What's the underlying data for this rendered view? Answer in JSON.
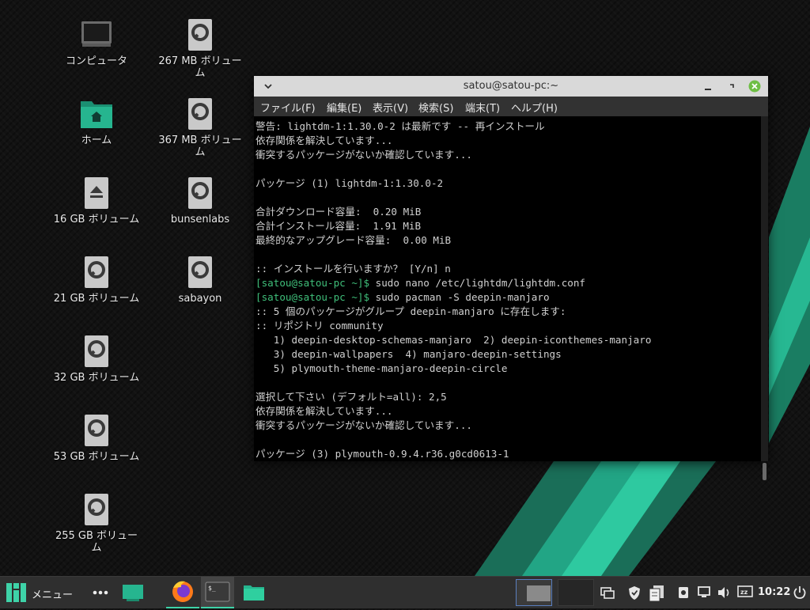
{
  "desktop_icons": [
    {
      "label": "コンピュータ",
      "icon": "monitor-icon"
    },
    {
      "label": "267 MB ボリューム",
      "icon": "drive-icon"
    },
    {
      "label": "ホーム",
      "icon": "home-folder-icon"
    },
    {
      "label": "367 MB ボリューム",
      "icon": "drive-icon"
    },
    {
      "label": "16 GB ボリューム",
      "icon": "eject-drive-icon"
    },
    {
      "label": "bunsenlabs",
      "icon": "drive-icon"
    },
    {
      "label": "21 GB ボリューム",
      "icon": "drive-icon"
    },
    {
      "label": "sabayon",
      "icon": "drive-icon"
    },
    {
      "label": "32 GB ボリューム",
      "icon": "drive-icon"
    },
    {
      "label": "53 GB ボリューム",
      "icon": "drive-icon"
    },
    {
      "label": "255 GB ボリューム",
      "icon": "drive-icon"
    }
  ],
  "terminal": {
    "title": "satou@satou-pc:~",
    "menu": [
      "ファイル(F)",
      "編集(E)",
      "表示(V)",
      "検索(S)",
      "端末(T)",
      "ヘルプ(H)"
    ],
    "lines": [
      {
        "text": "警告: lightdm-1:1.30.0-2 は最新です -- 再インストール"
      },
      {
        "text": "依存関係を解決しています..."
      },
      {
        "text": "衝突するパッケージがないか確認しています..."
      },
      {
        "text": ""
      },
      {
        "text": "パッケージ (1) lightdm-1:1.30.0-2"
      },
      {
        "text": ""
      },
      {
        "text": "合計ダウンロード容量:  0.20 MiB"
      },
      {
        "text": "合計インストール容量:  1.91 MiB"
      },
      {
        "text": "最終的なアップグレード容量:  0.00 MiB"
      },
      {
        "text": ""
      },
      {
        "text": ":: インストールを行いますか？ [Y/n] n"
      },
      {
        "prompt": "[satou@satou-pc ~]$",
        "text": " sudo nano /etc/lightdm/lightdm.conf"
      },
      {
        "prompt": "[satou@satou-pc ~]$",
        "text": " sudo pacman -S deepin-manjaro"
      },
      {
        "text": ":: 5 個のパッケージがグループ deepin-manjaro に存在します:"
      },
      {
        "text": ":: リポジトリ community"
      },
      {
        "text": "   1) deepin-desktop-schemas-manjaro  2) deepin-iconthemes-manjaro"
      },
      {
        "text": "   3) deepin-wallpapers  4) manjaro-deepin-settings"
      },
      {
        "text": "   5) plymouth-theme-manjaro-deepin-circle"
      },
      {
        "text": ""
      },
      {
        "text": "選択して下さい (デフォルト=all): 2,5"
      },
      {
        "text": "依存関係を解決しています..."
      },
      {
        "text": "衝突するパッケージがないか確認しています..."
      },
      {
        "text": ""
      },
      {
        "text": "パッケージ (3) plymouth-0.9.4.r36.g0cd0613-1"
      }
    ]
  },
  "taskbar": {
    "menu_label": "メニュー",
    "clock": "10:22"
  },
  "colors": {
    "accent": "#1fbf8f",
    "prompt": "#3fbf7a",
    "close_button": "#6ebe44"
  }
}
